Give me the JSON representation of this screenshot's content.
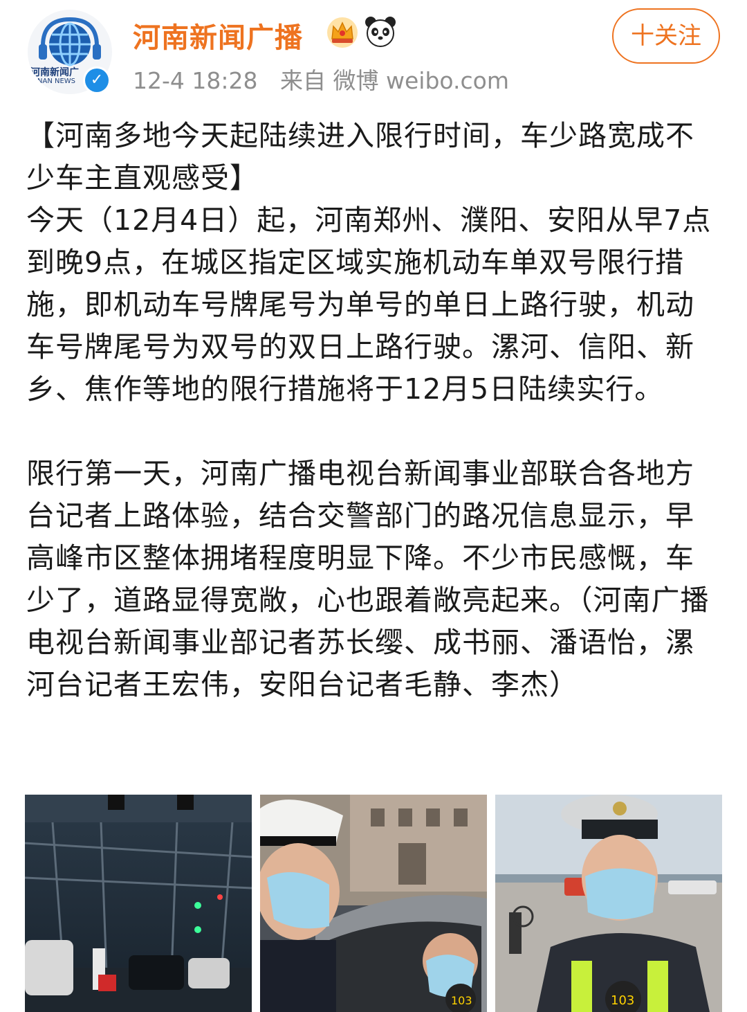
{
  "header": {
    "user_name": "河南新闻广播",
    "avatar_text": "河南新闻广",
    "avatar_subtext": "NAN NEWS",
    "time": "12-4 18:28",
    "source": "来自 微博 weibo.com",
    "follow_label": "十关注"
  },
  "post": {
    "title": "【河南多地今天起陆续进入限行时间，车少路宽成不少车主直观感受】",
    "paragraph1": "今天（12月4日）起，河南郑州、濮阳、安阳从早7点到晚9点，在城区指定区域实施机动车单双号限行措施，即机动车号牌尾号为单号的单日上路行驶，机动车号牌尾号为双号的双日上路行驶。漯河、信阳、新乡、焦作等地的限行措施将于12月5日陆续实行。",
    "paragraph2": "限行第一天，河南广播电视台新闻事业部联合各地方台记者上路体验，结合交警部门的路况信息显示，早高峰市区整体拥堵程度明显下降。不少市民感慨，车少了，道路显得宽敞，心也跟着敞亮起来。（河南广播电视台新闻事业部记者苏长缨、成书丽、潘语怡，漯河台记者王宏伟，安阳台记者毛静、李杰）"
  },
  "images": [
    {
      "icon": "traffic-road-photo"
    },
    {
      "icon": "police-checking-driver-photo"
    },
    {
      "icon": "police-officer-interview-photo"
    }
  ],
  "colors": {
    "accent": "#ee7320",
    "verified": "#1e8ee6",
    "meta": "#8e8e8e"
  }
}
